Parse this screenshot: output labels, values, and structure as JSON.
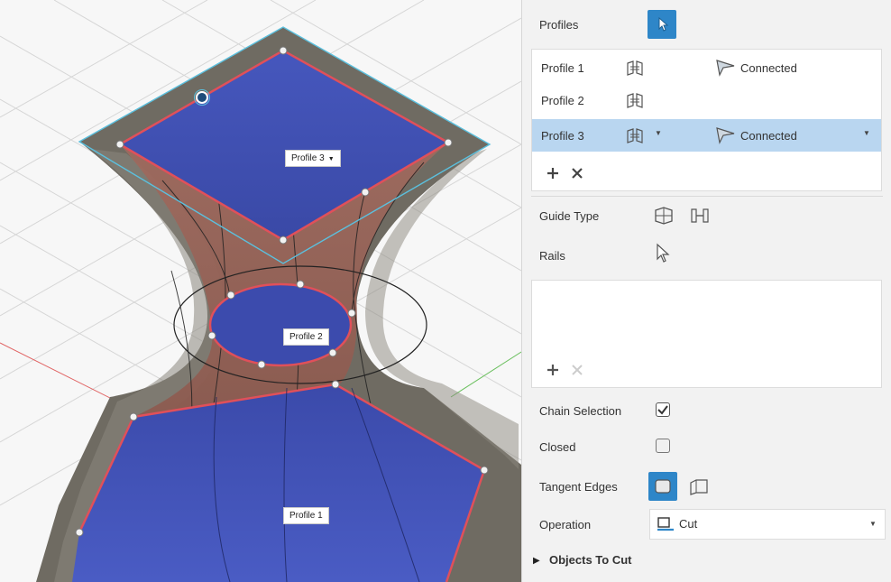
{
  "viewport": {
    "labels": {
      "profile3": "Profile 3",
      "profile2": "Profile 2",
      "profile1": "Profile 1"
    }
  },
  "panel": {
    "profiles_label": "Profiles",
    "profiles_list": [
      {
        "name": "Profile 1",
        "status": "Connected"
      },
      {
        "name": "Profile 2",
        "status": ""
      },
      {
        "name": "Profile 3",
        "status": "Connected"
      }
    ],
    "guide_type_label": "Guide Type",
    "rails_label": "Rails",
    "chain_selection_label": "Chain Selection",
    "chain_selection_checked": true,
    "closed_label": "Closed",
    "closed_checked": false,
    "tangent_edges_label": "Tangent Edges",
    "operation_label": "Operation",
    "operation_value": "Cut",
    "objects_to_cut_label": "Objects To Cut"
  },
  "colors": {
    "accent": "#2e86c8",
    "selected_row": "#b9d6f0",
    "profile_face": "#3d4fb0",
    "profile_edge": "#e0505a",
    "body_surface": "#6e6a60",
    "sketch_line": "#5bc0de"
  }
}
